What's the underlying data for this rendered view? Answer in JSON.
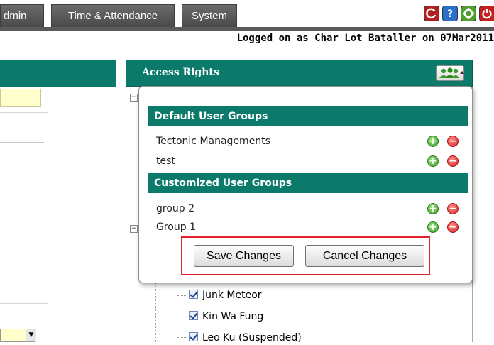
{
  "nav": {
    "tabs": [
      {
        "label": "dmin"
      },
      {
        "label": "Time & Attendance"
      },
      {
        "label": "System"
      }
    ],
    "icons": [
      "refresh-icon",
      "help-icon",
      "gear-icon",
      "power-icon"
    ]
  },
  "logon_text": "Logged on as Char Lot Bataller on 07Mar2011",
  "access_rights": {
    "title": "Access Rights",
    "groups_button_icon": "users-icon"
  },
  "popup": {
    "default_header": "Default User Groups",
    "default_groups": [
      {
        "name": "Tectonic Managements"
      },
      {
        "name": "test"
      }
    ],
    "custom_header": "Customized User Groups",
    "custom_groups": [
      {
        "name": "group 2"
      },
      {
        "name": "Group 1"
      }
    ],
    "save_label": "Save Changes",
    "cancel_label": "Cancel Changes"
  },
  "tree": {
    "items": [
      {
        "label": "Junk Meteor"
      },
      {
        "label": "Kin Wa Fung"
      },
      {
        "label": "Leo Ku (Suspended)"
      }
    ]
  },
  "colors": {
    "header_teal": "#0b7a6a",
    "highlight_red": "#e0222b",
    "add_green": "#3c9d2b",
    "remove_red": "#d62525"
  }
}
